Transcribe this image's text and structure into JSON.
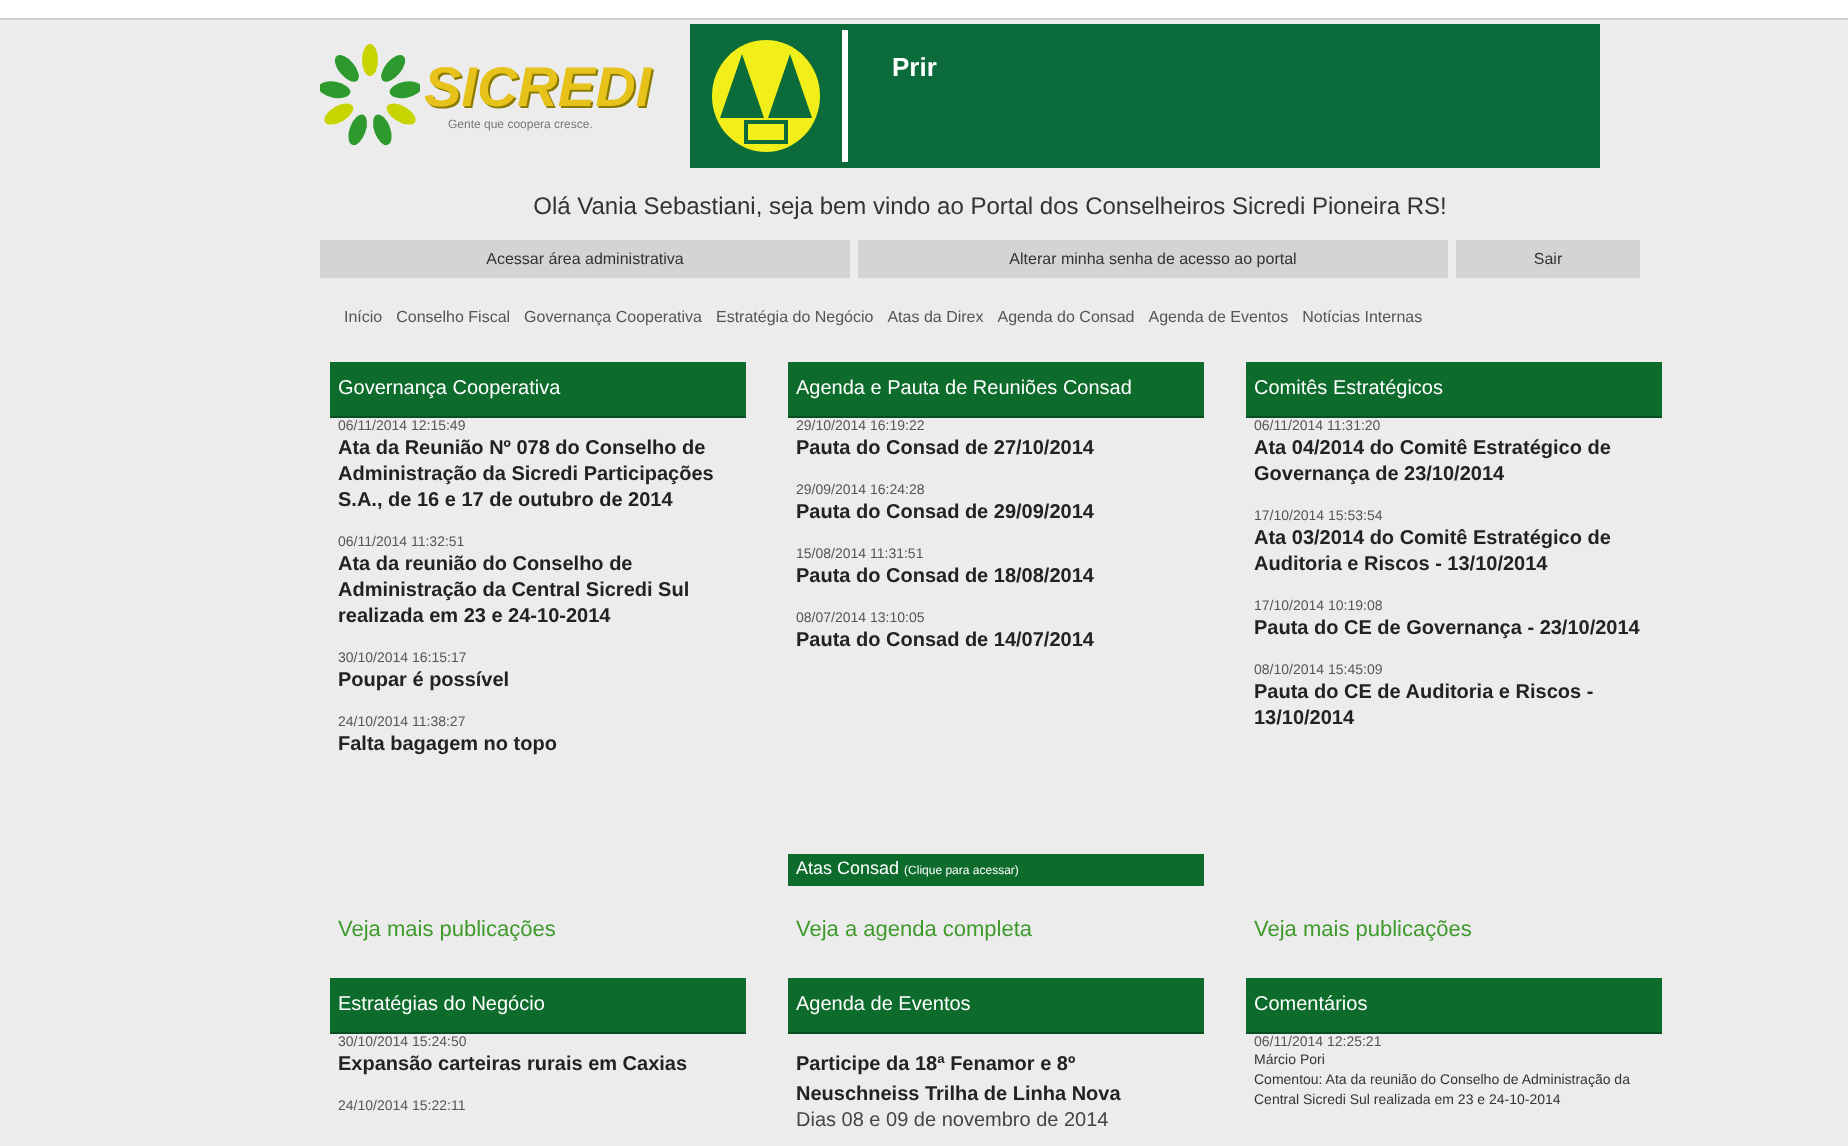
{
  "header": {
    "brand": "SICREDI",
    "tagline": "Gente que coopera cresce.",
    "banner_title": "Prir"
  },
  "greeting": "Olá Vania Sebastiani, seja bem vindo ao Portal dos Conselheiros Sicredi Pioneira RS!",
  "actions": [
    "Acessar área administrativa",
    "Alterar minha senha de acesso ao portal",
    "Sair"
  ],
  "nav": [
    "Início",
    "Conselho Fiscal",
    "Governança Cooperativa",
    "Estratégia do Negócio",
    "Atas da Direx",
    "Agenda do Consad",
    "Agenda de Eventos",
    "Notícias Internas"
  ],
  "panels": [
    {
      "title": "Governança Cooperativa",
      "items": [
        {
          "kind": "post",
          "date": "06/11/2014 12:15:49",
          "title": "Ata da Reunião Nº 078 do Conselho de Administração da Sicredi Participações S.A., de 16 e 17 de outubro de 2014"
        },
        {
          "kind": "post",
          "date": "06/11/2014 11:32:51",
          "title": "Ata da reunião do Conselho de Administração da Central Sicredi Sul realizada em 23 e 24-10-2014"
        },
        {
          "kind": "post",
          "date": "30/10/2014 16:15:17",
          "title": "Poupar é possível"
        },
        {
          "kind": "post",
          "date": "24/10/2014 11:38:27",
          "title": "Falta bagagem no topo"
        }
      ],
      "footer_link": "Veja mais publicações"
    },
    {
      "title": "Agenda e Pauta de Reuniões Consad",
      "items": [
        {
          "kind": "post",
          "date": "29/10/2014 16:19:22",
          "title": "Pauta do Consad de 27/10/2014"
        },
        {
          "kind": "post",
          "date": "29/09/2014 16:24:28",
          "title": "Pauta do Consad de 29/09/2014"
        },
        {
          "kind": "post",
          "date": "15/08/2014 11:31:51",
          "title": "Pauta do Consad de 18/08/2014"
        },
        {
          "kind": "post",
          "date": "08/07/2014 13:10:05",
          "title": "Pauta do Consad de 14/07/2014"
        }
      ],
      "sub_bar": {
        "label": "Atas Consad",
        "hint": "(Clique para acessar)"
      },
      "footer_link": "Veja a agenda completa"
    },
    {
      "title": "Comitês Estratégicos",
      "items": [
        {
          "kind": "post",
          "date": "06/11/2014 11:31:20",
          "title": "Ata 04/2014 do Comitê Estratégico de Governança de 23/10/2014"
        },
        {
          "kind": "post",
          "date": "17/10/2014 15:53:54",
          "title": "Ata 03/2014 do Comitê Estratégico de Auditoria e Riscos - 13/10/2014"
        },
        {
          "kind": "post",
          "date": "17/10/2014 10:19:08",
          "title": "Pauta do CE de Governança - 23/10/2014"
        },
        {
          "kind": "post",
          "date": "08/10/2014 15:45:09",
          "title": "Pauta do CE de Auditoria e Riscos - 13/10/2014"
        }
      ],
      "footer_link": "Veja mais publicações"
    },
    {
      "title": "Estratégias do Negócio",
      "items": [
        {
          "kind": "post",
          "date": "30/10/2014 15:24:50",
          "title": "Expansão carteiras rurais em Caxias"
        },
        {
          "kind": "post",
          "date": "24/10/2014 15:22:11"
        }
      ]
    },
    {
      "title": "Agenda de Eventos",
      "items": [
        {
          "kind": "event",
          "title": "Participe da 18ª Fenamor e 8º Neuschneiss Trilha de Linha Nova",
          "subtitle": "Dias 08 e 09 de novembro de 2014"
        }
      ]
    },
    {
      "title": "Comentários",
      "items": [
        {
          "kind": "comment",
          "date": "06/11/2014 12:25:21",
          "author": "Márcio Pori",
          "text": "Comentou: Ata da reunião do Conselho de Administração da Central Sicredi Sul realizada em 23 e 24-10-2014"
        }
      ]
    }
  ]
}
